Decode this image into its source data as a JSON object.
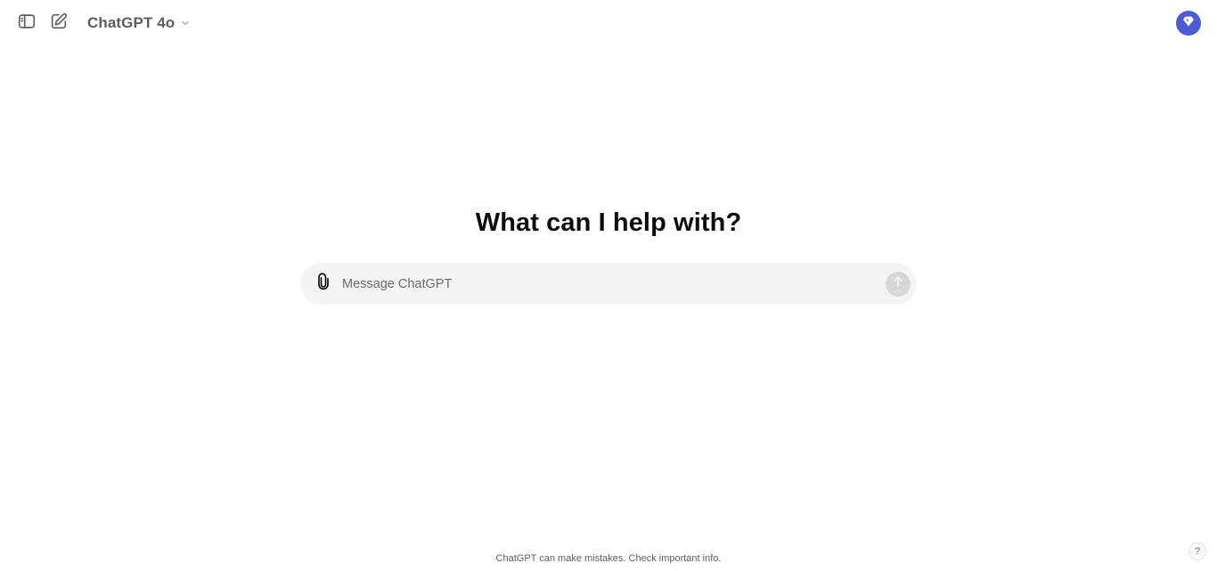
{
  "header": {
    "model_name": "ChatGPT 4o",
    "icons": {
      "sidebar_toggle": "sidebar-toggle-icon",
      "new_chat": "new-chat-icon",
      "model_chevron": "chevron-down-icon",
      "upgrade": "diamond-icon"
    },
    "accent_color": "#4d5bd6"
  },
  "main": {
    "heading": "What can I help with?",
    "composer": {
      "placeholder": "Message ChatGPT",
      "value": "",
      "attach_icon": "paperclip-icon",
      "send_icon": "arrow-up-icon"
    }
  },
  "footer": {
    "disclaimer": "ChatGPT can make mistakes. Check important info.",
    "help_label": "?"
  }
}
